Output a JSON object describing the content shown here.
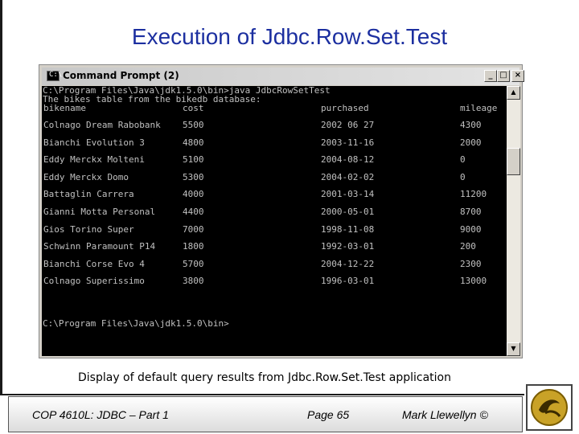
{
  "slide": {
    "title": "Execution of Jdbc.Row.Set.Test",
    "caption": "Display of default query results from Jdbc.Row.Set.Test application"
  },
  "window": {
    "title": "Command Prompt (2)",
    "icon_label": "C:\\",
    "controls": {
      "minimize": "_",
      "maximize": "□",
      "close": "×"
    }
  },
  "console": {
    "command_line": "C:\\Program Files\\Java\\jdk1.5.0\\bin>java JdbcRowSetTest",
    "info_line": "The bikes table from the bikedb database:",
    "headers": [
      "bikename",
      "cost",
      "purchased",
      "mileage"
    ],
    "rows": [
      [
        "Colnago Dream Rabobank",
        "5500",
        "2002 06 27",
        "4300"
      ],
      [
        "Bianchi Evolution 3",
        "4800",
        "2003-11-16",
        "2000"
      ],
      [
        "Eddy Merckx Molteni",
        "5100",
        "2004-08-12",
        "0"
      ],
      [
        "Eddy Merckx Domo",
        "5300",
        "2004-02-02",
        "0"
      ],
      [
        "Battaglin Carrera",
        "4000",
        "2001-03-14",
        "11200"
      ],
      [
        "Gianni Motta Personal",
        "4400",
        "2000-05-01",
        "8700"
      ],
      [
        "Gios Torino Super",
        "7000",
        "1998-11-08",
        "9000"
      ],
      [
        "Schwinn Paramount P14",
        "1800",
        "1992-03-01",
        "200"
      ],
      [
        "Bianchi Corse Evo 4",
        "5700",
        "2004-12-22",
        "2300"
      ],
      [
        "Colnago Superissimo",
        "3800",
        "1996-03-01",
        "13000"
      ]
    ],
    "final_prompt": "C:\\Program Files\\Java\\jdk1.5.0\\bin>"
  },
  "scrollbar": {
    "up": "▲",
    "down": "▼"
  },
  "footer": {
    "course": "COP 4610L: JDBC – Part 1",
    "page": "Page 65",
    "author": "Mark Llewellyn ©"
  }
}
